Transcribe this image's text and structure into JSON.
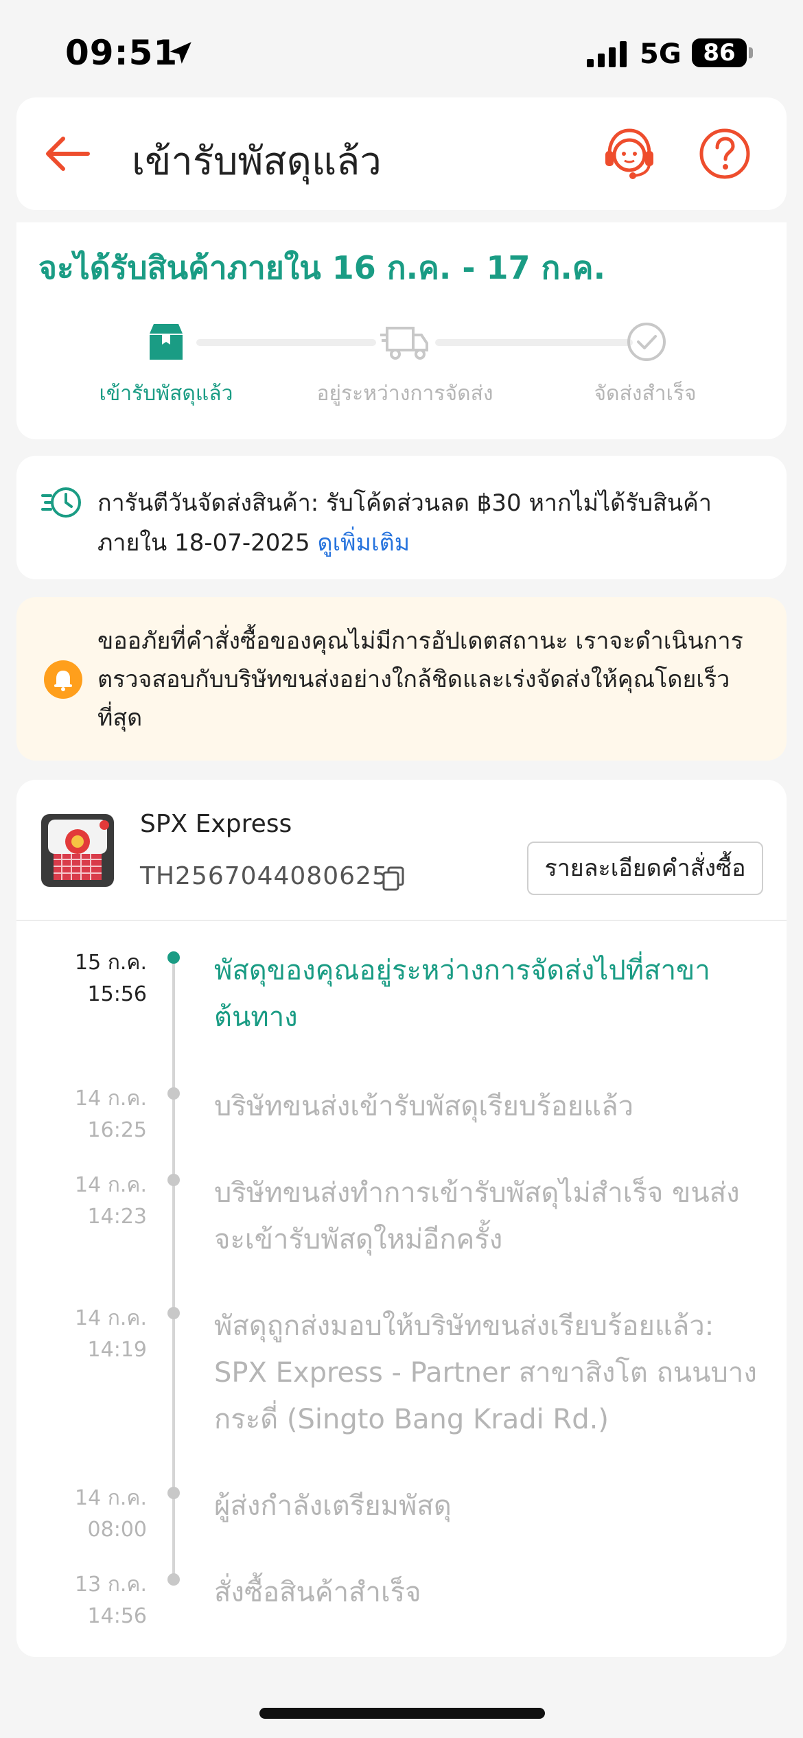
{
  "status_bar": {
    "time": "09:51",
    "network": "5G",
    "battery": "86"
  },
  "header": {
    "title": "เข้ารับพัสดุแล้ว"
  },
  "progress": {
    "eta": "จะได้รับสินค้าภายใน 16 ก.ค. - 17 ก.ค.",
    "steps": [
      {
        "label": "เข้ารับพัสดุแล้ว",
        "icon": "package-box-icon",
        "active": true
      },
      {
        "label": "อยู่ระหว่างการจัดส่ง",
        "icon": "delivery-truck-icon",
        "active": false
      },
      {
        "label": "จัดส่งสำเร็จ",
        "icon": "check-circle-icon",
        "active": false
      }
    ],
    "accent_color": "#1a9c84"
  },
  "guarantee": {
    "text": "การันตีวันจัดส่งสินค้า: รับโค้ดส่วนลด ฿30 หากไม่ได้รับสินค้าภายใน 18-07-2025 ",
    "link": "ดูเพิ่มเติม"
  },
  "apology": {
    "text": "ขออภัยที่คำสั่งซื้อของคุณไม่มีการอัปเดตสถานะ เราจะดำเนินการตรวจสอบกับบริษัทขนส่งอย่างใกล้ชิดและเร่งจัดส่งให้คุณโดยเร็วที่สุด"
  },
  "shipment": {
    "carrier": "SPX Express",
    "tracking_number": "TH2567044080625",
    "order_details_button": "รายละเอียดคำสั่งซื้อ"
  },
  "timeline": [
    {
      "date": "15 ก.ค.",
      "time": "15:56",
      "description": "พัสดุของคุณอยู่ระหว่างการจัดส่งไปที่สาขาต้นทาง",
      "active": true
    },
    {
      "date": "14 ก.ค.",
      "time": "16:25",
      "description": "บริษัทขนส่งเข้ารับพัสดุเรียบร้อยแล้ว",
      "active": false
    },
    {
      "date": "14 ก.ค.",
      "time": "14:23",
      "description": "บริษัทขนส่งทำการเข้ารับพัสดุไม่สำเร็จ ขนส่งจะเข้ารับพัสดุใหม่อีกครั้ง",
      "active": false
    },
    {
      "date": "14 ก.ค.",
      "time": "14:19",
      "description": "พัสดุถูกส่งมอบให้บริษัทขนส่งเรียบร้อยแล้ว: SPX Express - Partner สาขาสิงโต ถนนบางกระดี่ (Singto Bang Kradi Rd.)",
      "active": false
    },
    {
      "date": "14 ก.ค.",
      "time": "08:00",
      "description": " ผู้ส่งกำลังเตรียมพัสดุ",
      "active": false
    },
    {
      "date": "13 ก.ค.",
      "time": "14:56",
      "description": "สั่งซื้อสินค้าสำเร็จ",
      "active": false
    }
  ]
}
